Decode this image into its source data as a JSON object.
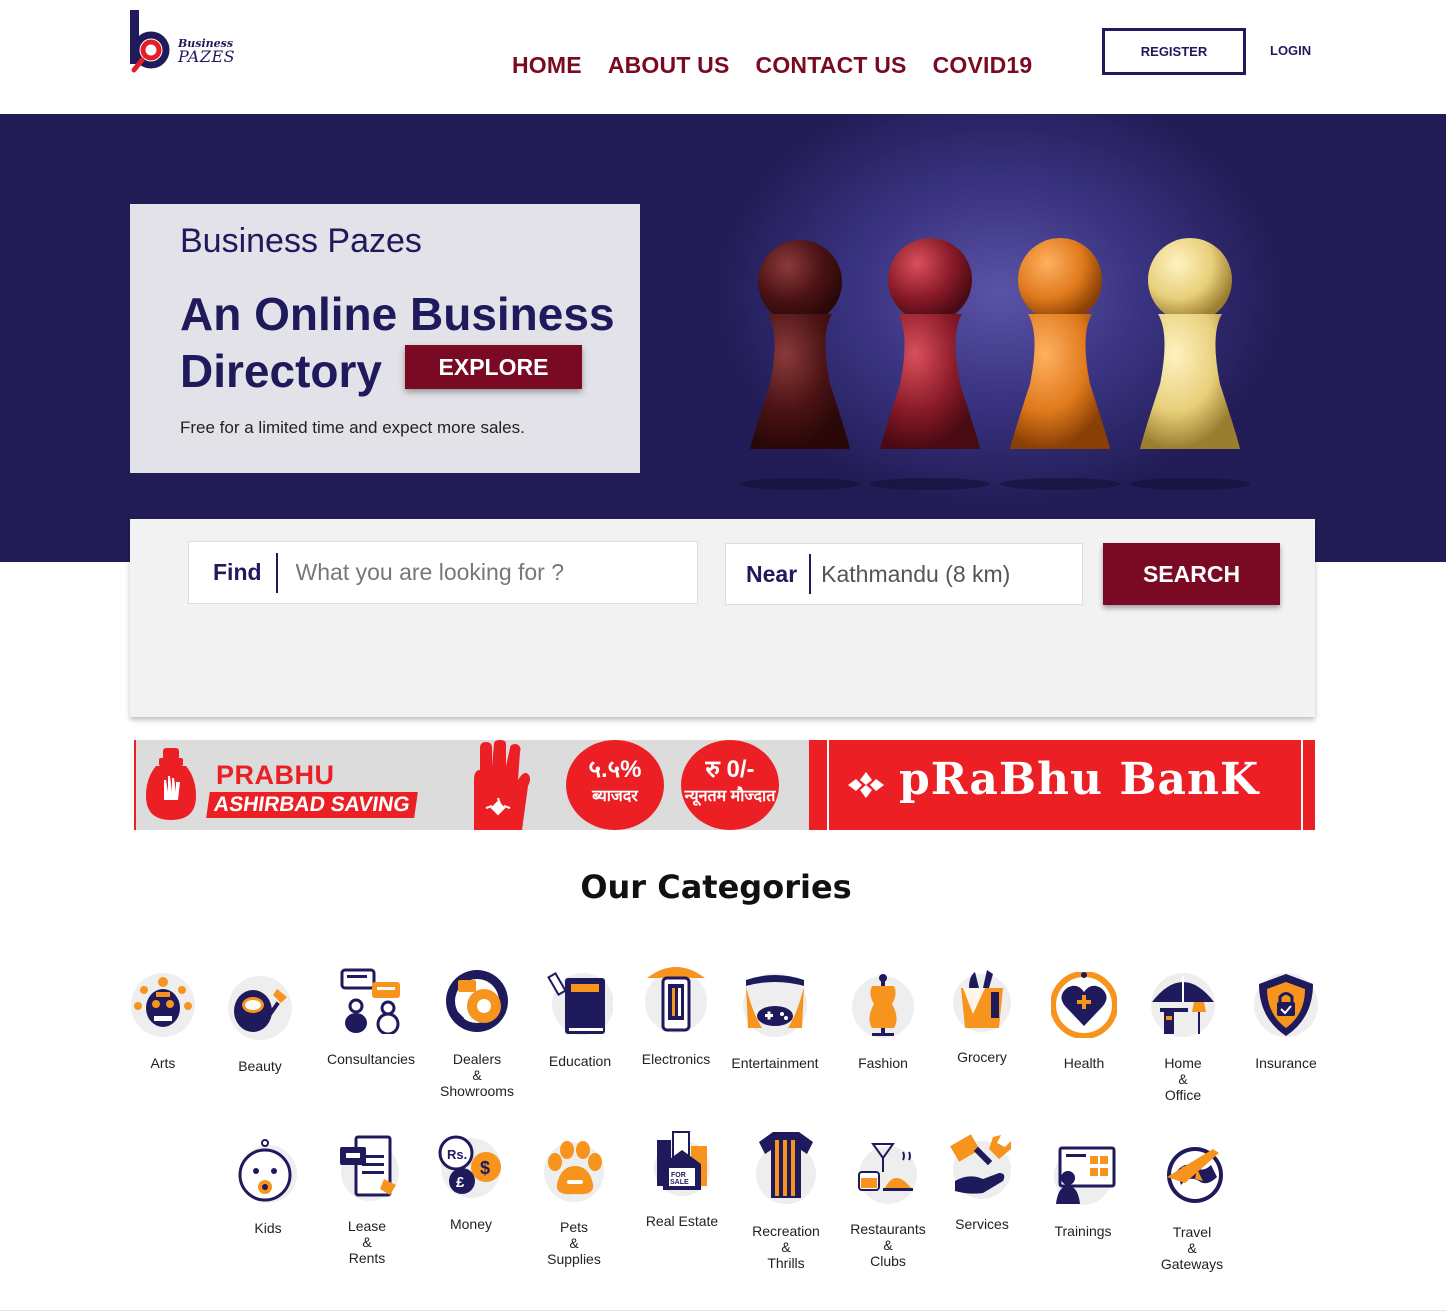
{
  "header": {
    "logo_line1": "Business",
    "logo_line2": "PAZES",
    "nav": [
      "HOME",
      "ABOUT US",
      "CONTACT US",
      "COVID19"
    ],
    "register_label": "REGISTER",
    "login_label": "LOGIN"
  },
  "hero": {
    "brand": "Business Pazes",
    "headline": "An Online Business Directory",
    "explore_label": "EXPLORE",
    "subtitle": "Free for a limited time and expect more sales."
  },
  "search": {
    "find_label": "Find",
    "find_placeholder": "What you are looking for ?",
    "near_label": "Near",
    "near_value": "Kathmandu (8 km)",
    "button_label": "SEARCH"
  },
  "banner": {
    "title": "PRABHU",
    "subtitle": "ASHIRBAD SAVING",
    "badge1_big": "५.५%",
    "badge1_small": "ब्याजदर",
    "badge2_big": "रु 0/-",
    "badge2_small": "न्यूनतम मौज्दात",
    "bank_name": "pRaBhu BanK"
  },
  "categories_title": "Our Categories",
  "categories_row1": [
    {
      "label": "Arts",
      "icon": "arts-icon"
    },
    {
      "label": "Beauty",
      "icon": "beauty-icon"
    },
    {
      "label": "Consultancies",
      "icon": "consultancies-icon"
    },
    {
      "label": "Dealers\n&\nShowrooms",
      "icon": "dealers-icon"
    },
    {
      "label": "Education",
      "icon": "education-icon"
    },
    {
      "label": "Electronics",
      "icon": "electronics-icon"
    },
    {
      "label": "Entertainment",
      "icon": "entertainment-icon"
    },
    {
      "label": "Fashion",
      "icon": "fashion-icon"
    },
    {
      "label": "Grocery",
      "icon": "grocery-icon"
    },
    {
      "label": "Health",
      "icon": "health-icon"
    },
    {
      "label": "Home\n&\nOffice",
      "icon": "home-office-icon"
    },
    {
      "label": "Insurance",
      "icon": "insurance-icon"
    }
  ],
  "categories_row2": [
    {
      "label": "Kids",
      "icon": "kids-icon"
    },
    {
      "label": "Lease\n&\nRents",
      "icon": "lease-icon"
    },
    {
      "label": "Money",
      "icon": "money-icon"
    },
    {
      "label": "Pets\n&\nSupplies",
      "icon": "pets-icon"
    },
    {
      "label": "Real Estate",
      "icon": "real-estate-icon"
    },
    {
      "label": "Recreation\n&\nThrills",
      "icon": "recreation-icon"
    },
    {
      "label": "Restaurants\n&\nClubs",
      "icon": "restaurants-icon"
    },
    {
      "label": "Services",
      "icon": "services-icon"
    },
    {
      "label": "Trainings",
      "icon": "trainings-icon"
    },
    {
      "label": "Travel\n&\nGateways",
      "icon": "travel-icon"
    }
  ],
  "colors": {
    "navy": "#1f1a5c",
    "maroon": "#7a0a23",
    "orange": "#f7941d",
    "bank_red": "#ec1f25"
  }
}
